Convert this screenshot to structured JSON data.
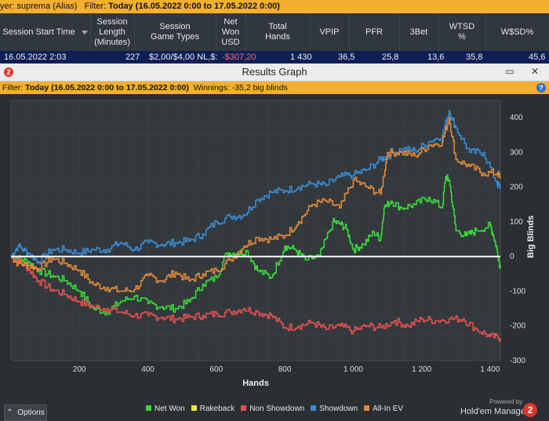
{
  "top_filter": {
    "player_label": "yer: suprema (Alias)",
    "filter_label": "Filter:",
    "filter_value": "Today (16.05.2022 0:00 to 17.05.2022 0:00)"
  },
  "table": {
    "headers": [
      "Session Start Time",
      "Session Length (Minutes)",
      "Session Game Types",
      "Net Won USD",
      "Total Hands",
      "VPIP",
      "PFR",
      "3Bet",
      "WTSD %",
      "W$SD%"
    ],
    "row": [
      "16.05.2022 2:03",
      "227",
      "$2,00/$4,00 NL,$:",
      "-$307,20",
      "1 430",
      "36,5",
      "25,8",
      "13,6",
      "35,8",
      "45,6"
    ],
    "negative_color": "#ff6b6b"
  },
  "window": {
    "title": "Results Graph",
    "minimize": "▭",
    "close": "✕"
  },
  "graph_filter": {
    "label": "Filter:",
    "value": "Today (16.05.2022 0:00 to 17.05.2022 0:00)",
    "winnings": "Winnings: -35,2 big blinds"
  },
  "chart_data": {
    "type": "line",
    "xlabel": "Hands",
    "ylabel": "Big Blinds",
    "xlim": [
      0,
      1430
    ],
    "ylim": [
      -300,
      450
    ],
    "xticks": [
      200,
      400,
      600,
      800,
      1000,
      1200,
      1400
    ],
    "xtick_labels": [
      "200",
      "400",
      "600",
      "800",
      "1 000",
      "1 200",
      "1 400"
    ],
    "yticks": [
      -300,
      -200,
      -100,
      0,
      100,
      200,
      300,
      400
    ],
    "grid": true,
    "legend_position": "bottom",
    "zero_line": true,
    "series": [
      {
        "name": "Net Won",
        "color": "#3ad63a",
        "x": [
          0,
          20,
          50,
          80,
          120,
          160,
          200,
          240,
          280,
          320,
          360,
          400,
          440,
          480,
          520,
          560,
          600,
          630,
          660,
          690,
          720,
          760,
          800,
          830,
          860,
          900,
          940,
          960,
          980,
          1000,
          1030,
          1060,
          1080,
          1090,
          1110,
          1140,
          1180,
          1220,
          1260,
          1270,
          1280,
          1300,
          1330,
          1360,
          1400,
          1410,
          1420,
          1430
        ],
        "y": [
          0,
          -5,
          -15,
          -40,
          -55,
          -70,
          -100,
          -150,
          -160,
          -130,
          -115,
          -135,
          -145,
          -150,
          -130,
          -80,
          -60,
          10,
          10,
          15,
          -40,
          -60,
          30,
          20,
          -10,
          0,
          100,
          95,
          80,
          20,
          35,
          70,
          50,
          140,
          160,
          140,
          150,
          170,
          140,
          230,
          220,
          75,
          60,
          75,
          90,
          60,
          20,
          -35
        ]
      },
      {
        "name": "Rakeback",
        "color": "#f3e33a",
        "x": [],
        "y": []
      },
      {
        "name": "Non Showdown",
        "color": "#e05050",
        "x": [
          0,
          20,
          50,
          80,
          120,
          160,
          200,
          240,
          280,
          320,
          360,
          400,
          440,
          480,
          520,
          560,
          600,
          640,
          680,
          720,
          760,
          800,
          840,
          880,
          920,
          960,
          1000,
          1040,
          1080,
          1120,
          1160,
          1200,
          1240,
          1280,
          1320,
          1360,
          1400,
          1430
        ],
        "y": [
          0,
          -10,
          -35,
          -70,
          -95,
          -110,
          -130,
          -145,
          -150,
          -160,
          -170,
          -170,
          -175,
          -180,
          -175,
          -170,
          -165,
          -160,
          -150,
          -160,
          -170,
          -205,
          -200,
          -190,
          -210,
          -200,
          -215,
          -200,
          -205,
          -185,
          -200,
          -180,
          -185,
          -180,
          -180,
          -210,
          -230,
          -235
        ]
      },
      {
        "name": "Showdown",
        "color": "#3a8ad0",
        "x": [
          0,
          20,
          50,
          80,
          120,
          160,
          200,
          240,
          280,
          320,
          360,
          400,
          440,
          480,
          520,
          560,
          600,
          640,
          680,
          720,
          760,
          800,
          840,
          880,
          920,
          960,
          1000,
          1040,
          1080,
          1100,
          1140,
          1180,
          1220,
          1260,
          1280,
          1300,
          1340,
          1380,
          1420,
          1430
        ],
        "y": [
          0,
          30,
          10,
          -15,
          20,
          20,
          10,
          20,
          20,
          40,
          20,
          40,
          35,
          40,
          45,
          65,
          100,
          115,
          120,
          165,
          185,
          190,
          200,
          210,
          205,
          230,
          235,
          250,
          280,
          290,
          310,
          305,
          330,
          350,
          420,
          370,
          300,
          300,
          210,
          200
        ]
      },
      {
        "name": "All-In EV",
        "color": "#e0883a",
        "x": [
          0,
          20,
          50,
          80,
          120,
          160,
          200,
          240,
          280,
          320,
          360,
          400,
          440,
          480,
          520,
          560,
          600,
          640,
          680,
          720,
          760,
          800,
          840,
          880,
          920,
          960,
          1000,
          1040,
          1080,
          1100,
          1140,
          1180,
          1220,
          1260,
          1280,
          1300,
          1340,
          1380,
          1420,
          1430
        ],
        "y": [
          0,
          -20,
          -25,
          -35,
          -5,
          -20,
          -40,
          -80,
          -90,
          -100,
          -95,
          -55,
          -70,
          -45,
          -70,
          -50,
          -40,
          -10,
          30,
          55,
          50,
          60,
          100,
          150,
          160,
          140,
          220,
          200,
          180,
          300,
          300,
          290,
          320,
          330,
          400,
          280,
          260,
          240,
          240,
          230
        ]
      }
    ]
  },
  "footer": {
    "options_label": "Options",
    "options_arrow": "⌃",
    "powered_by": "Powered by",
    "brand": "Hold'em Manager",
    "brand_badge": "2"
  }
}
